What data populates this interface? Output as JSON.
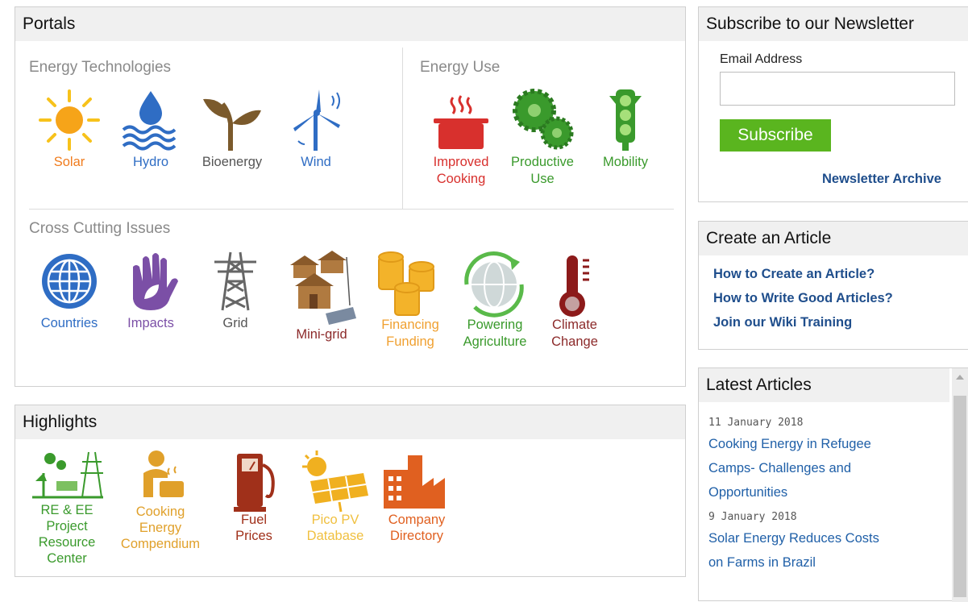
{
  "portals": {
    "title": "Portals",
    "energy_technologies": {
      "title": "Energy Technologies",
      "items": [
        {
          "label": "Solar",
          "icon": "sun-icon",
          "color": "#f07c1e"
        },
        {
          "label": "Hydro",
          "icon": "water-drop-waves-icon",
          "color": "#2f6dc4"
        },
        {
          "label": "Bioenergy",
          "icon": "plant-sprout-icon",
          "color": "#555555"
        },
        {
          "label": "Wind",
          "icon": "wind-turbine-icon",
          "color": "#2f6dc4"
        }
      ]
    },
    "energy_use": {
      "title": "Energy Use",
      "items": [
        {
          "label1": "Improved",
          "label2": "Cooking",
          "icon": "cooking-pot-icon",
          "color": "#d8302d"
        },
        {
          "label1": "Productive",
          "label2": "Use",
          "icon": "gears-icon",
          "color": "#3a9a2c"
        },
        {
          "label": "Mobility",
          "icon": "traffic-light-icon",
          "color": "#3a9a2c"
        }
      ]
    },
    "cross_cutting": {
      "title": "Cross Cutting Issues",
      "items": [
        {
          "label": "Countries",
          "icon": "globe-icon",
          "color": "#2f6dc4"
        },
        {
          "label": "Impacts",
          "icon": "hand-leaf-icon",
          "color": "#7b4fa6"
        },
        {
          "label": "Grid",
          "icon": "power-pylon-icon",
          "color": "#555555"
        },
        {
          "label": "Mini-grid",
          "icon": "huts-solar-icon",
          "color": "#8c2a2a"
        },
        {
          "label1": "Financing",
          "label2": "Funding",
          "icon": "coins-icon",
          "color": "#f0a030"
        },
        {
          "label1": "Powering",
          "label2": "Agriculture",
          "icon": "globe-arrows-icon",
          "color": "#3a9a2c"
        },
        {
          "label1": "Climate",
          "label2": "Change",
          "icon": "thermometer-icon",
          "color": "#8c2a2a"
        }
      ]
    }
  },
  "highlights": {
    "title": "Highlights",
    "items": [
      {
        "lines": [
          "RE & EE",
          "Project",
          "Resource",
          "Center"
        ],
        "icon": "wind-solar-tower-icon",
        "color": "#3a9a2c"
      },
      {
        "lines": [
          "Cooking",
          "Energy",
          "Compendium"
        ],
        "icon": "cook-person-icon",
        "color": "#e0a02a"
      },
      {
        "lines": [
          "Fuel",
          "Prices"
        ],
        "icon": "fuel-pump-icon",
        "color": "#a0301a"
      },
      {
        "lines": [
          "Pico PV",
          "Database"
        ],
        "icon": "solar-panel-sun-icon",
        "color": "#f0b020"
      },
      {
        "lines": [
          "Company",
          "Directory"
        ],
        "icon": "factory-icon",
        "color": "#e06020"
      }
    ]
  },
  "newsletter": {
    "title": "Subscribe to our Newsletter",
    "email_label": "Email Address",
    "email_value": "",
    "subscribe_label": "Subscribe",
    "archive_label": "Newsletter Archive"
  },
  "create_article": {
    "title": "Create an Article",
    "links": [
      "How to Create an Article?",
      "How to Write Good Articles?",
      "Join our Wiki Training"
    ]
  },
  "latest": {
    "title": "Latest Articles",
    "articles": [
      {
        "date": "11 January 2018",
        "lines": [
          "Cooking Energy in Refugee",
          "Camps- Challenges and",
          "Opportunities"
        ]
      },
      {
        "date": "9 January 2018",
        "lines": [
          "Solar Energy Reduces Costs",
          "on Farms in Brazil"
        ]
      }
    ]
  }
}
